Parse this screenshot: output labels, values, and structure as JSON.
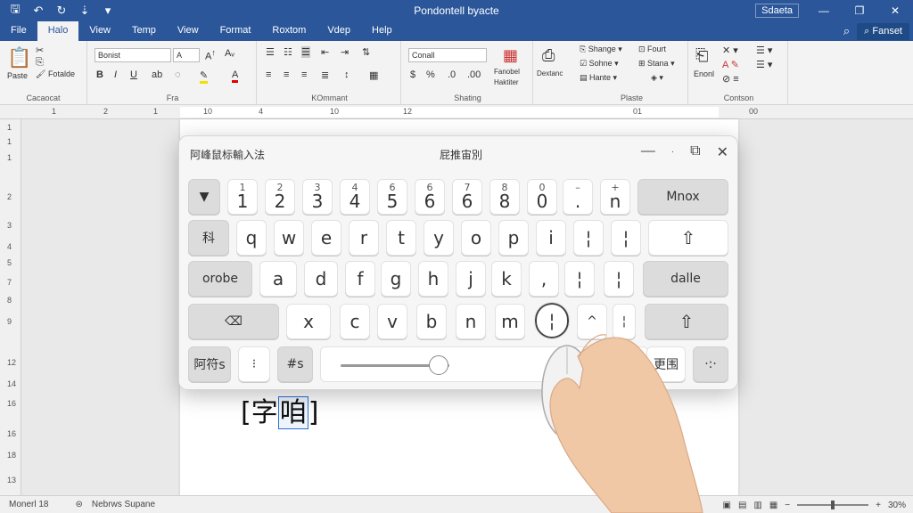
{
  "titlebar": {
    "doc_title": "Pondontell byacte",
    "account": "Sdaeta",
    "qat_icons": [
      "save-icon",
      "undo-icon",
      "redo-icon",
      "customize-icon"
    ]
  },
  "tabs": {
    "items": [
      "File",
      "Halo",
      "View",
      "Temp",
      "View",
      "Format",
      "Roxtom",
      "Vdep",
      "Help"
    ],
    "search_label": "Fanset"
  },
  "ribbon": {
    "clipboard": {
      "label": "Cacaocat",
      "paste": "Paste",
      "formats": "Fotalde"
    },
    "font": {
      "label": "Fra",
      "font_name": "Bonist",
      "font_size": "A"
    },
    "paragraph": {
      "label": "KOmmant"
    },
    "styles": {
      "label": "Shating",
      "style_name": "Conall",
      "btn1": "Fanobel",
      "btn2": "Haktiter"
    },
    "btn_dextanc": "Dextanc",
    "editing": {
      "label": "Plaste",
      "r1": "Shange",
      "r2": "Sohne",
      "r3": "Hante",
      "r4": "Fourt",
      "r5": "Stana"
    },
    "group6": {
      "label": "Contson",
      "btn": "Enonl"
    }
  },
  "ruler": {
    "marks": [
      "1",
      "2",
      "1",
      "10",
      "4",
      "10",
      "12",
      "01",
      "00"
    ]
  },
  "vruler": {
    "marks": [
      "1",
      "1",
      "1",
      "2",
      "3",
      "4",
      "5",
      "7",
      "8",
      "9",
      "12",
      "14",
      "16",
      "16",
      "18",
      "13"
    ]
  },
  "doc": {
    "text_before": "[字",
    "text_selected": "咱",
    "text_after": "]"
  },
  "keyboard": {
    "title": "阿峰鼠标輸入法",
    "mode": "屁推宙別",
    "row1": [
      {
        "sub": "",
        "main": "▼"
      },
      {
        "sub": "1",
        "main": "1"
      },
      {
        "sub": "2",
        "main": "2"
      },
      {
        "sub": "3",
        "main": "3"
      },
      {
        "sub": "4",
        "main": "4"
      },
      {
        "sub": "6",
        "main": "5"
      },
      {
        "sub": "6",
        "main": "6"
      },
      {
        "sub": "7",
        "main": "6"
      },
      {
        "sub": "8",
        "main": "8"
      },
      {
        "sub": "0",
        "main": "0"
      },
      {
        "sub": "–",
        "main": "."
      },
      {
        "sub": "+",
        "main": "n"
      }
    ],
    "mnox": "Mnox",
    "row2_left": "科",
    "row2": [
      "q",
      "w",
      "e",
      "r",
      "t",
      "y",
      "o",
      "p",
      "i",
      "¦",
      "¦"
    ],
    "row2_right": "⇧",
    "row3_left": "orobe",
    "row3": [
      "a",
      "d",
      "f",
      "g",
      "h",
      "j",
      "k",
      ",",
      "¦",
      "¦"
    ],
    "row3_right": "dalle",
    "row4_left": "⌫",
    "row4": [
      "x",
      "c",
      "v",
      "b",
      "n",
      "m",
      "¦",
      "^",
      "¦"
    ],
    "row4_right": "⇧",
    "row5": [
      "阿符s",
      "⁝",
      "#s"
    ],
    "space_right": "更围",
    "last": "·:·",
    "slider_level": 0.9
  },
  "status": {
    "page": "Monerl 18",
    "words": "Nebrws Supane",
    "zoom": "30%"
  }
}
